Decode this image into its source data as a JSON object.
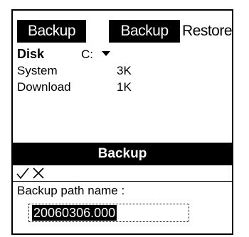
{
  "tabs": {
    "app_title": "Backup",
    "backup": "Backup",
    "restore": "Restore"
  },
  "disk": {
    "label": "Disk",
    "selected": "C:"
  },
  "entries": [
    {
      "name": "System",
      "size": "3K"
    },
    {
      "name": "Download",
      "size": "1K"
    }
  ],
  "dialog": {
    "title": "Backup",
    "ok_icon": "checkmark-icon",
    "cancel_icon": "close-icon",
    "path_label": "Backup path name :",
    "path_value": "20060306.000"
  }
}
